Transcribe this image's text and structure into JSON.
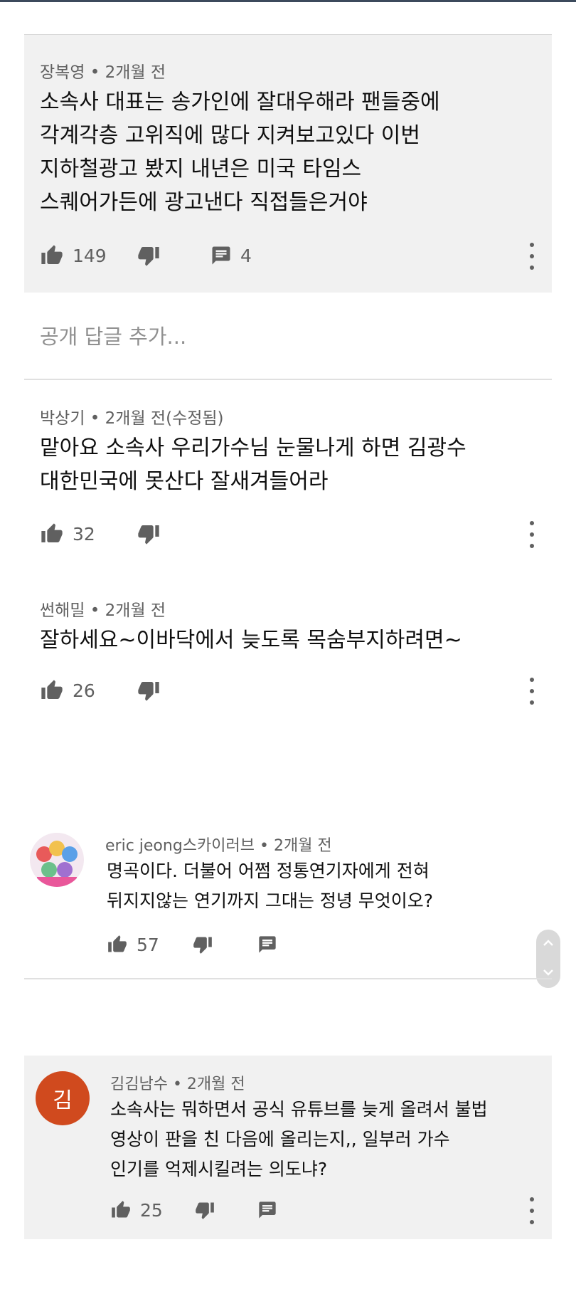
{
  "comments": [
    {
      "author": "장복영",
      "time": " • 2개월 전",
      "text": "소속사 대표는 송가인에 잘대우해라  팬들중에\n각계각층 고위직에 많다 지켜보고있다 이번\n지하철광고 봤지 내년은 미국 타임스\n스퀘어가든에 광고낸다 직접들은거야",
      "likes": "149",
      "replies": "4"
    },
    {
      "author": "박상기",
      "time": " • 2개월 전(수정됨)",
      "text": "맡아요 소속사 우리가수님  눈물나게 하면 김광수\n대한민국에 못산다 잘새겨들어라",
      "likes": "32"
    },
    {
      "author": "썬해밀",
      "time": " • 2개월 전",
      "text": "잘하세요~이바닥에서 늦도록 목숨부지하려면~",
      "likes": "26"
    },
    {
      "author": "eric jeong스카이러브",
      "time": " • 2개월 전",
      "text": "명곡이다. 더불어 어쩜 정통연기자에게 전혀\n뒤지지않는 연기까지 그대는 정녕 무엇이오?",
      "likes": "57"
    },
    {
      "author": "김김남수",
      "time": " • 2개월 전",
      "avatar_letter": "김",
      "text": "소속사는 뭐하면서 공식 유튜브를 늦게 올려서 불법\n영상이 판을 친 다음에  올리는지,, 일부러 가수\n인기를 억제시킬려는 의도냐?",
      "likes": "25"
    }
  ],
  "reply_placeholder": "공개 답글 추가...",
  "colors": {
    "avatar_kim": "#d04a1e",
    "card_bg": "#f1f1f1",
    "meta": "#606060"
  },
  "icons": [
    "thumbs-up-icon",
    "thumbs-down-icon",
    "reply-icon",
    "more-vert-icon",
    "chevron-up-icon",
    "chevron-down-icon"
  ]
}
